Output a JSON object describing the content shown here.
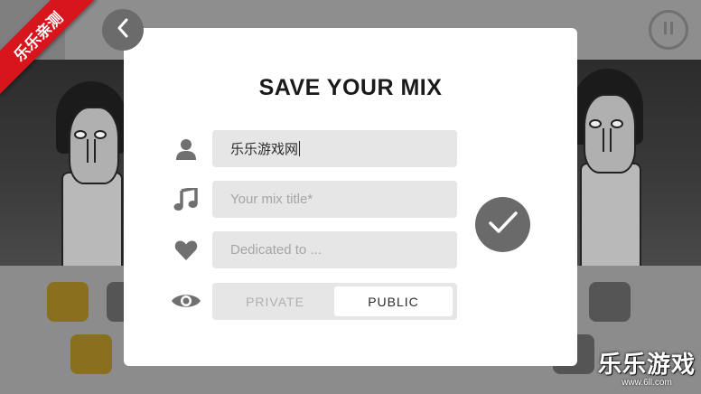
{
  "dialog": {
    "title": "SAVE YOUR MIX",
    "author_field": {
      "value": "乐乐游戏网",
      "icon": "person-icon"
    },
    "title_field": {
      "placeholder": "Your mix title*",
      "icon": "music-note-icon"
    },
    "dedication_field": {
      "placeholder": "Dedicated to ...",
      "icon": "heart-icon"
    },
    "visibility": {
      "icon": "eye-icon",
      "options": [
        "PRIVATE",
        "PUBLIC"
      ],
      "selected": "PUBLIC"
    },
    "confirm_icon": "checkmark-icon"
  },
  "nav": {
    "back_icon": "chevron-left-icon",
    "pause_icon": "pause-icon"
  },
  "watermark": {
    "ribbon_text": "乐乐亲测",
    "logo_text": "乐乐游戏",
    "logo_url": "www.6ll.com"
  },
  "colors": {
    "overlay": "#8c8c8c",
    "dialog_bg": "#ffffff",
    "field_bg": "#e6e6e6",
    "icon_gray": "#707070",
    "ribbon_red": "#d8141d"
  }
}
